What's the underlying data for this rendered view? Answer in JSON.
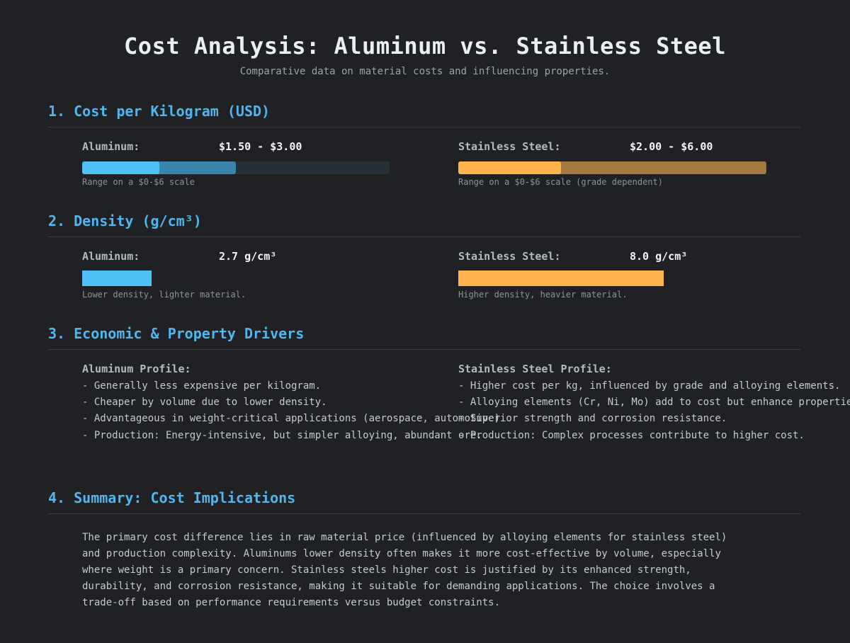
{
  "title": "Cost Analysis: Aluminum vs. Stainless Steel",
  "subtitle": "Comparative data on material costs and influencing properties.",
  "sections": {
    "cost": {
      "heading": "1. Cost per Kilogram (USD)",
      "scale_max": 6,
      "aluminum": {
        "label": "Aluminum:",
        "value": "$1.50 - $3.00",
        "min": 1.5,
        "max": 3.0,
        "note": "Range on a $0-$6 scale",
        "color": "#4fc1f6"
      },
      "stainless": {
        "label": "Stainless Steel:",
        "value": "$2.00 - $6.00",
        "min": 2.0,
        "max": 6.0,
        "note": "Range on a $0-$6 scale (grade dependent)",
        "color": "#ffb34a"
      }
    },
    "density": {
      "heading": "2. Density (g/cm³)",
      "scale_max": 12,
      "aluminum": {
        "label": "Aluminum:",
        "value": "2.7 g/cm³",
        "amount": 2.7,
        "note": "Lower density, lighter material.",
        "color": "#4fc1f6"
      },
      "stainless": {
        "label": "Stainless Steel:",
        "value": "8.0 g/cm³",
        "amount": 8.0,
        "note": "Higher density, heavier material.",
        "color": "#ffb34a"
      }
    },
    "drivers": {
      "heading": "3. Economic & Property Drivers",
      "aluminum": {
        "title": "Aluminum Profile:",
        "items": [
          "- Generally less expensive per kilogram.",
          "- Cheaper by volume due to lower density.",
          "- Advantageous in weight-critical applications (aerospace, automotive).",
          "- Production: Energy-intensive, but simpler alloying, abundant ore."
        ]
      },
      "stainless": {
        "title": "Stainless Steel Profile:",
        "items": [
          "- Higher cost per kg, influenced by grade and alloying elements.",
          "- Alloying elements (Cr, Ni, Mo) add to cost but enhance properties.",
          "- Superior strength and corrosion resistance.",
          "- Production: Complex processes contribute to higher cost."
        ]
      }
    },
    "summary": {
      "heading": "4. Summary: Cost Implications",
      "text": "The primary cost difference lies in raw material price (influenced by alloying elements for stainless steel) and production complexity. Aluminums lower density often makes it more cost-effective by volume, especially where weight is a primary concern. Stainless steels higher cost is justified by its enhanced strength, durability, and corrosion resistance, making it suitable for demanding applications. The choice involves a trade-off based on performance requirements versus budget constraints."
    }
  }
}
